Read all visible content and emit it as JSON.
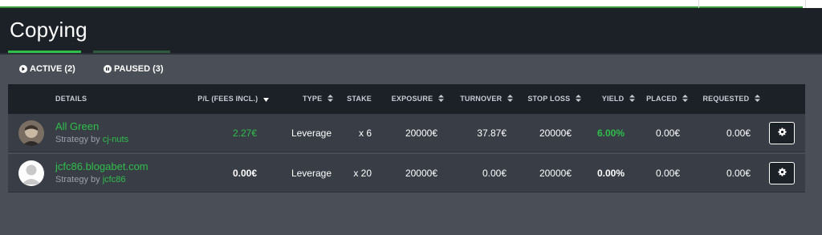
{
  "page": {
    "title": "Copying"
  },
  "filters": [
    {
      "label": "ACTIVE (2)",
      "icon": "play-circle-icon"
    },
    {
      "label": "PAUSED (3)",
      "icon": "pause-circle-icon"
    }
  ],
  "table": {
    "headers": {
      "details": "DETAILS",
      "pl": "P/L (FEES INCL.)",
      "type": "TYPE",
      "stake": "STAKE",
      "exposure": "EXPOSURE",
      "turnover": "TURNOVER",
      "stop_loss": "STOP LOSS",
      "yield": "YIELD",
      "placed": "PLACED",
      "requested": "REQUESTED"
    },
    "rows": [
      {
        "name": "All Green",
        "strategy_prefix": "Strategy by ",
        "strategy_user": "cj-nuts",
        "pl": "2.27€",
        "type": "Leverage",
        "stake": "x 6",
        "exposure": "20000€",
        "turnover": "37.87€",
        "stop_loss": "20000€",
        "yield": "6.00%",
        "placed": "0.00€",
        "requested": "0.00€"
      },
      {
        "name": "jcfc86.blogabet.com",
        "strategy_prefix": "Strategy by ",
        "strategy_user": "jcfc86",
        "pl": "0.00€",
        "type": "Leverage",
        "stake": "x 20",
        "exposure": "20000€",
        "turnover": "0.00€",
        "stop_loss": "20000€",
        "yield": "0.00%",
        "placed": "0.00€",
        "requested": "0.00€"
      }
    ]
  },
  "colors": {
    "accent_green": "#2fbf4a",
    "header_bg": "#1c2027",
    "row_bg": "#383d46",
    "page_bg": "#4a4f57"
  }
}
